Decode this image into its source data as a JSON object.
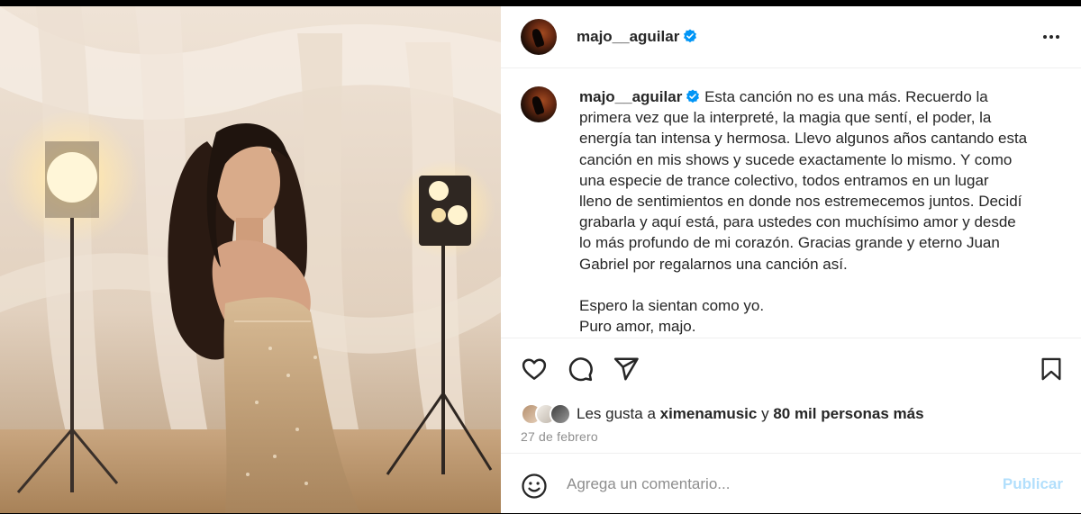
{
  "post": {
    "username": "majo__aguilar",
    "verified": true,
    "menu_icon": "more-horizontal-icon"
  },
  "caption": {
    "username": "majo__aguilar",
    "lines": [
      "Esta canción no es una más. Recuerdo la",
      "primera vez que la interpreté, la magia que sentí, el poder, la",
      "energía tan intensa y hermosa. Llevo algunos años cantando esta",
      "canción en mis shows y sucede exactamente lo mismo. Y como",
      "una especie de trance colectivo, todos entramos en un lugar",
      "lleno de sentimientos en donde nos estremecemos juntos. Decidí",
      "grabarla y aquí está, para ustedes con muchísimo amor y desde",
      "lo más profundo de mi corazón. Gracias grande y eterno Juan",
      "Gabriel por regalarnos una canción así."
    ],
    "closing": [
      "Espero la sientan como yo.",
      "Puro amor, majo."
    ]
  },
  "actions": {
    "icons": [
      "heart-icon",
      "comment-icon",
      "share-icon",
      "bookmark-icon"
    ]
  },
  "likes": {
    "prefix": "Les gusta a ",
    "user": "ximenamusic",
    "middle": " y ",
    "others": "80 mil personas más"
  },
  "date": "27 de febrero",
  "comment": {
    "placeholder": "Agrega un comentario...",
    "publish_label": "Publicar",
    "emoji_icon": "emoji-smile-icon"
  },
  "colors": {
    "verified": "#0095f6",
    "publish_disabled": "#b2dffc",
    "muted": "#8e8e8e"
  }
}
